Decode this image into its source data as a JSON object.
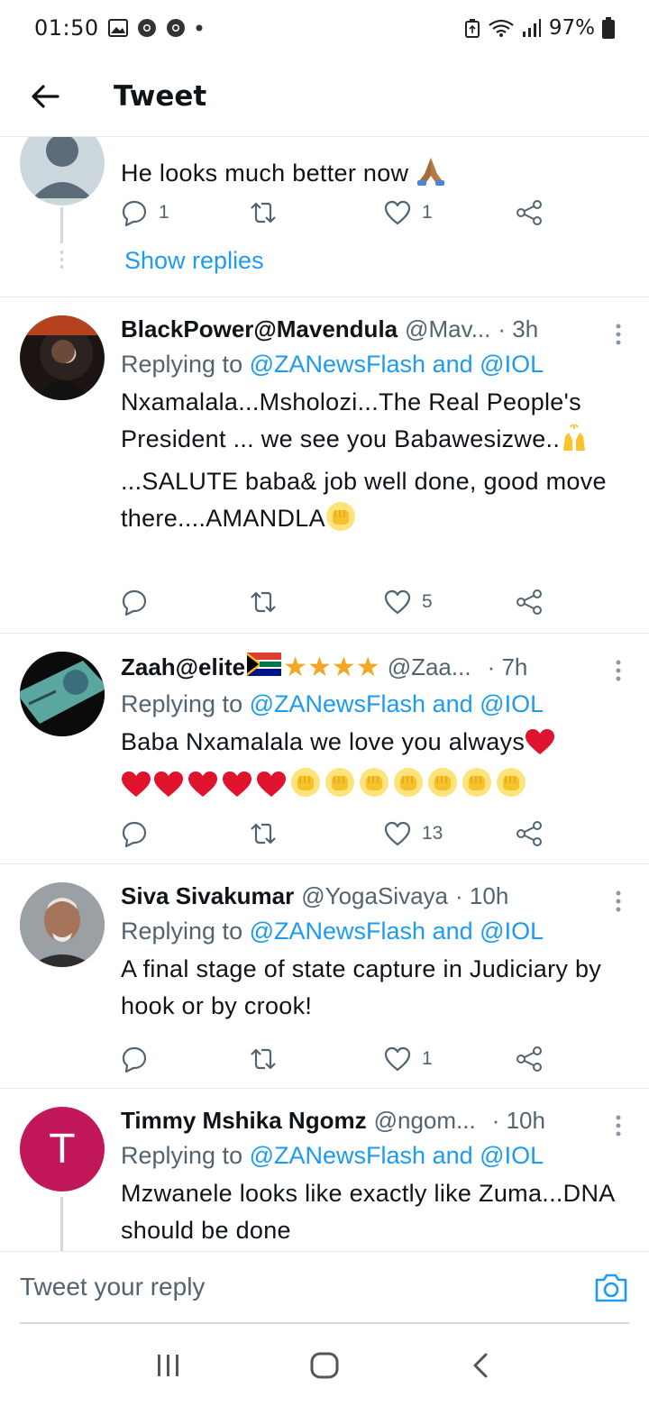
{
  "status_bar": {
    "time": "01:50",
    "battery": "97%"
  },
  "header": {
    "title": "Tweet"
  },
  "colors": {
    "accent": "#1d9bf0",
    "secondary_text": "#536471",
    "avatar_t": "#c2185b"
  },
  "first_tweet": {
    "text": "He looks much better now",
    "reply_count": "1",
    "like_count": "1",
    "show_replies": "Show replies"
  },
  "tweets": [
    {
      "display_name": "BlackPower@Mavendula",
      "handle": "@Mav...",
      "time": "· 3h",
      "replying_prefix": "Replying to",
      "mention1": "@ZANewsFlash",
      "and": "and",
      "mention2": "@IOL",
      "text1": "Nxamalala...Msholozi...The Real People's President ... we see you Babawesizwe..",
      "text2": "...SALUTE baba& job well done, good move there....AMANDLA",
      "reply_count": "",
      "like_count": "5"
    },
    {
      "display_name": "Zaah@elite",
      "handle": "@Zaa...",
      "time": "· 7h",
      "replying_prefix": "Replying to",
      "mention1": "@ZANewsFlash",
      "and": "and",
      "mention2": "@IOL",
      "text": "Baba Nxamalala we love you always",
      "reply_count": "",
      "like_count": "13"
    },
    {
      "display_name": "Siva Sivakumar",
      "handle": "@YogaSivaya",
      "time": "· 10h",
      "replying_prefix": "Replying to",
      "mention1": "@ZANewsFlash",
      "and": "and",
      "mention2": "@IOL",
      "text": "A final stage of state capture in Judiciary by hook or by crook!",
      "reply_count": "",
      "like_count": "1"
    },
    {
      "display_name": "Timmy Mshika Ngomz",
      "handle": "@ngom...",
      "time": "· 10h",
      "avatar_letter": "T",
      "replying_prefix": "Replying to",
      "mention1": "@ZANewsFlash",
      "and": "and",
      "mention2": "@IOL",
      "text": "Mzwanele looks like exactly like Zuma...DNA should be done"
    }
  ],
  "reply_bar": {
    "placeholder": "Tweet your reply"
  }
}
